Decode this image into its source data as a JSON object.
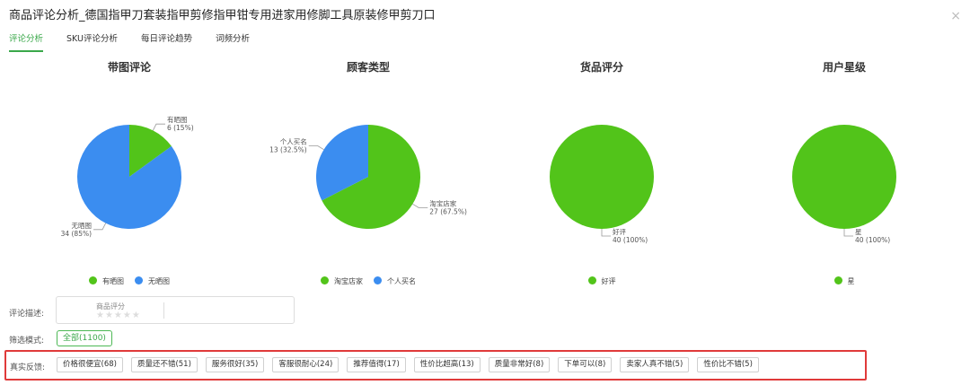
{
  "window": {
    "title": "商品评论分析_德国指甲刀套装指甲剪修指甲钳专用进家用修脚工具原装修甲剪刀口",
    "close_symbol": "×"
  },
  "tabs": [
    {
      "label": "评论分析",
      "active": true
    },
    {
      "label": "SKU评论分析",
      "active": false
    },
    {
      "label": "每日评论趋势",
      "active": false
    },
    {
      "label": "词频分析",
      "active": false
    }
  ],
  "colors": {
    "green": "#52c41a",
    "blue": "#3b8df0",
    "accent": "#3aa84a",
    "highlight_border": "#e03a3a"
  },
  "chart_data": [
    {
      "type": "pie",
      "title": "带图评论",
      "series": [
        {
          "name": "有晒图",
          "value": 6,
          "label": "有晒图",
          "value_label": "6 (15%)",
          "color": "#52c41a"
        },
        {
          "name": "无晒图",
          "value": 34,
          "label": "无晒图",
          "value_label": "34 (85%)",
          "color": "#3b8df0"
        }
      ],
      "legend": [
        "有晒图",
        "无晒图"
      ],
      "legend_position": "bottom"
    },
    {
      "type": "pie",
      "title": "顾客类型",
      "series": [
        {
          "name": "淘宝店家",
          "value": 27,
          "label": "淘宝店家",
          "value_label": "27 (67.5%)",
          "color": "#52c41a"
        },
        {
          "name": "个人买名",
          "value": 13,
          "label": "个人买名",
          "value_label": "13 (32.5%)",
          "color": "#3b8df0"
        }
      ],
      "legend": [
        "淘宝店家",
        "个人买名"
      ],
      "legend_position": "bottom"
    },
    {
      "type": "pie",
      "title": "货品评分",
      "series": [
        {
          "name": "好评",
          "value": 40,
          "label": "好评",
          "value_label": "40 (100%)",
          "color": "#52c41a"
        }
      ],
      "legend": [
        "好评"
      ],
      "legend_position": "bottom"
    },
    {
      "type": "pie",
      "title": "用户星级",
      "series": [
        {
          "name": "星",
          "value": 40,
          "label": "星",
          "value_label": "40 (100%)",
          "color": "#52c41a"
        }
      ],
      "legend": [
        "星"
      ],
      "legend_position": "bottom"
    }
  ],
  "description": {
    "label": "评论描述:",
    "sub_label": "商品评分",
    "stars": "★★★★★"
  },
  "filter": {
    "label": "筛选模式:",
    "button": "全部(1100)"
  },
  "feedback": {
    "label": "真实反馈:",
    "tags": [
      "价格很便宜(68)",
      "质量还不错(51)",
      "服务很好(35)",
      "客服很耐心(24)",
      "推荐值得(17)",
      "性价比超高(13)",
      "质量非常好(8)",
      "下单可以(8)",
      "卖家人真不错(5)",
      "性价比不错(5)"
    ]
  }
}
